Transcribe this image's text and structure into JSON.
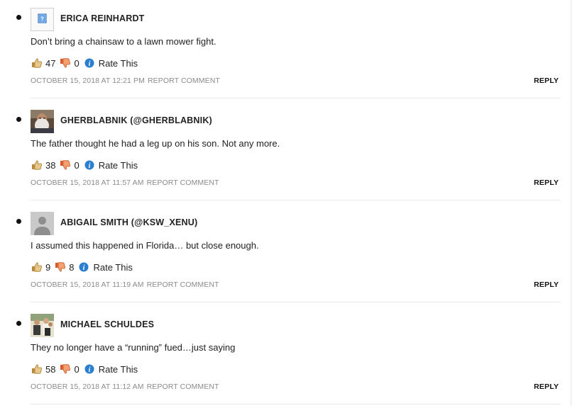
{
  "comments": [
    {
      "author": "ERICA REINHARDT",
      "avatar": "unknown-image-placeholder",
      "text": "Don’t bring a chainsaw to a lawn mower fight.",
      "likes": "47",
      "dislikes": "0",
      "rate_label": "Rate This",
      "timestamp": "OCTOBER 15, 2018 AT 12:21 PM",
      "report_label": "REPORT COMMENT",
      "reply_label": "REPLY"
    },
    {
      "author": "GHERBLABNIK (@GHERBLABNIK)",
      "avatar": "bearded-man-photo",
      "text": "The father thought he had a leg up on his son. Not any more.",
      "likes": "38",
      "dislikes": "0",
      "rate_label": "Rate This",
      "timestamp": "OCTOBER 15, 2018 AT 11:57 AM",
      "report_label": "REPORT COMMENT",
      "reply_label": "REPLY"
    },
    {
      "author": "ABIGAIL SMITH (@KSW_XENU)",
      "avatar": "default-person-silhouette",
      "text": "I assumed this happened in Florida… but close enough.",
      "likes": "9",
      "dislikes": "8",
      "rate_label": "Rate This",
      "timestamp": "OCTOBER 15, 2018 AT 11:19 AM",
      "report_label": "REPORT COMMENT",
      "reply_label": "REPLY"
    },
    {
      "author": "MICHAEL SCHULDES",
      "avatar": "group-photo",
      "text": "They no longer have a “running” fued…just saying",
      "likes": "58",
      "dislikes": "0",
      "rate_label": "Rate This",
      "timestamp": "OCTOBER 15, 2018 AT 11:12 AM",
      "report_label": "REPORT COMMENT",
      "reply_label": "REPLY"
    }
  ],
  "colors": {
    "thumbs_up": "#c9a45a",
    "thumbs_down": "#e8703a",
    "info": "#2a7fd0",
    "meta_text": "#8b8b8b"
  }
}
